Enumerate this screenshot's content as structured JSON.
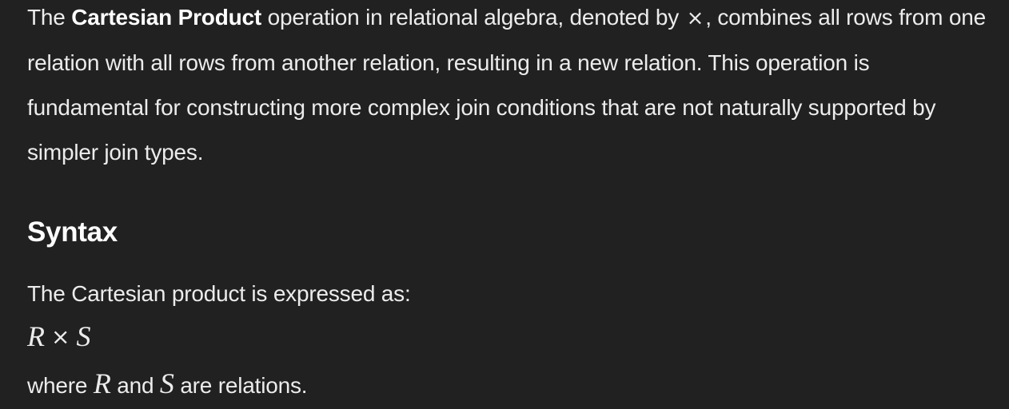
{
  "intro": {
    "text_before": "The ",
    "bold_term": "Cartesian Product",
    "text_after": " operation in relational algebra, denoted by ",
    "symbol": "×",
    "text_rest": ", combines all rows from one relation with all rows from another relation, resulting in a new relation. This operation is fundamental for constructing more complex join conditions that are not naturally supported by simpler join types."
  },
  "syntax": {
    "heading": "Syntax",
    "expressed_as": "The Cartesian product is expressed as:",
    "formula": {
      "left": "R",
      "operator": "×",
      "right": "S"
    },
    "where": {
      "prefix": "where ",
      "var1": "R",
      "middle": " and ",
      "var2": "S",
      "suffix": " are relations."
    }
  }
}
